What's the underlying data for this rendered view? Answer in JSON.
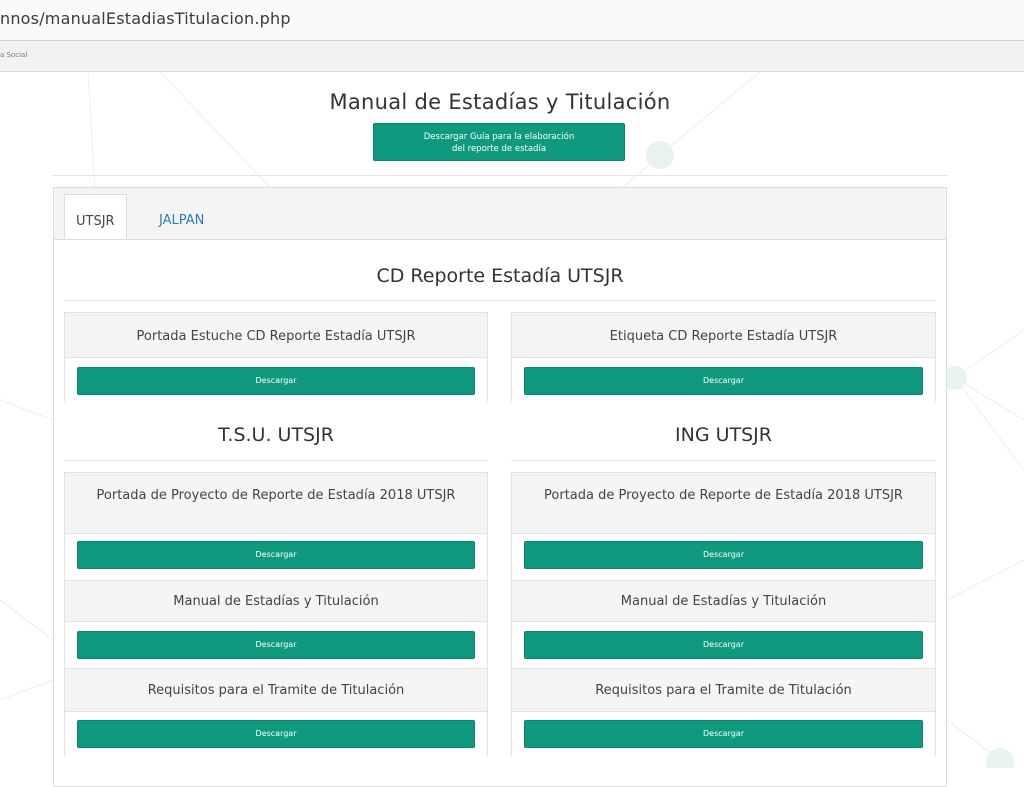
{
  "browser": {
    "url": "nnos/manualEstadiasTitulacion.php",
    "nav_text": "a Social"
  },
  "page": {
    "title": "Manual de Estadías y Titulación",
    "guide_button": "Descargar Guía para la elaboración\ndel reporte de estadía"
  },
  "tabs": [
    {
      "label": "UTSJR",
      "active": true
    },
    {
      "label": "JALPAN",
      "active": false
    }
  ],
  "cd_section": {
    "title": "CD Reporte Estadía UTSJR",
    "cards": [
      {
        "title": "Portada Estuche CD Reporte Estadía UTSJR",
        "button": "Descargar"
      },
      {
        "title": "Etiqueta CD Reporte Estadía UTSJR",
        "button": "Descargar"
      }
    ]
  },
  "tsu_section": {
    "title": "T.S.U. UTSJR",
    "cards": [
      {
        "title": "Portada de Proyecto de Reporte de Estadía 2018 UTSJR",
        "button": "Descargar"
      },
      {
        "title": "Manual de Estadías y Titulación",
        "button": "Descargar"
      },
      {
        "title": "Requisitos para el Tramite de Titulación",
        "button": "Descargar"
      }
    ]
  },
  "ing_section": {
    "title": "ING UTSJR",
    "cards": [
      {
        "title": "Portada de Proyecto de Reporte de Estadía 2018 UTSJR",
        "button": "Descargar"
      },
      {
        "title": "Manual de Estadías y Titulación",
        "button": "Descargar"
      },
      {
        "title": "Requisitos para el Tramite de Titulación",
        "button": "Descargar"
      }
    ]
  },
  "colors": {
    "accent": "#0f9a80",
    "link": "#2a7fb8"
  }
}
